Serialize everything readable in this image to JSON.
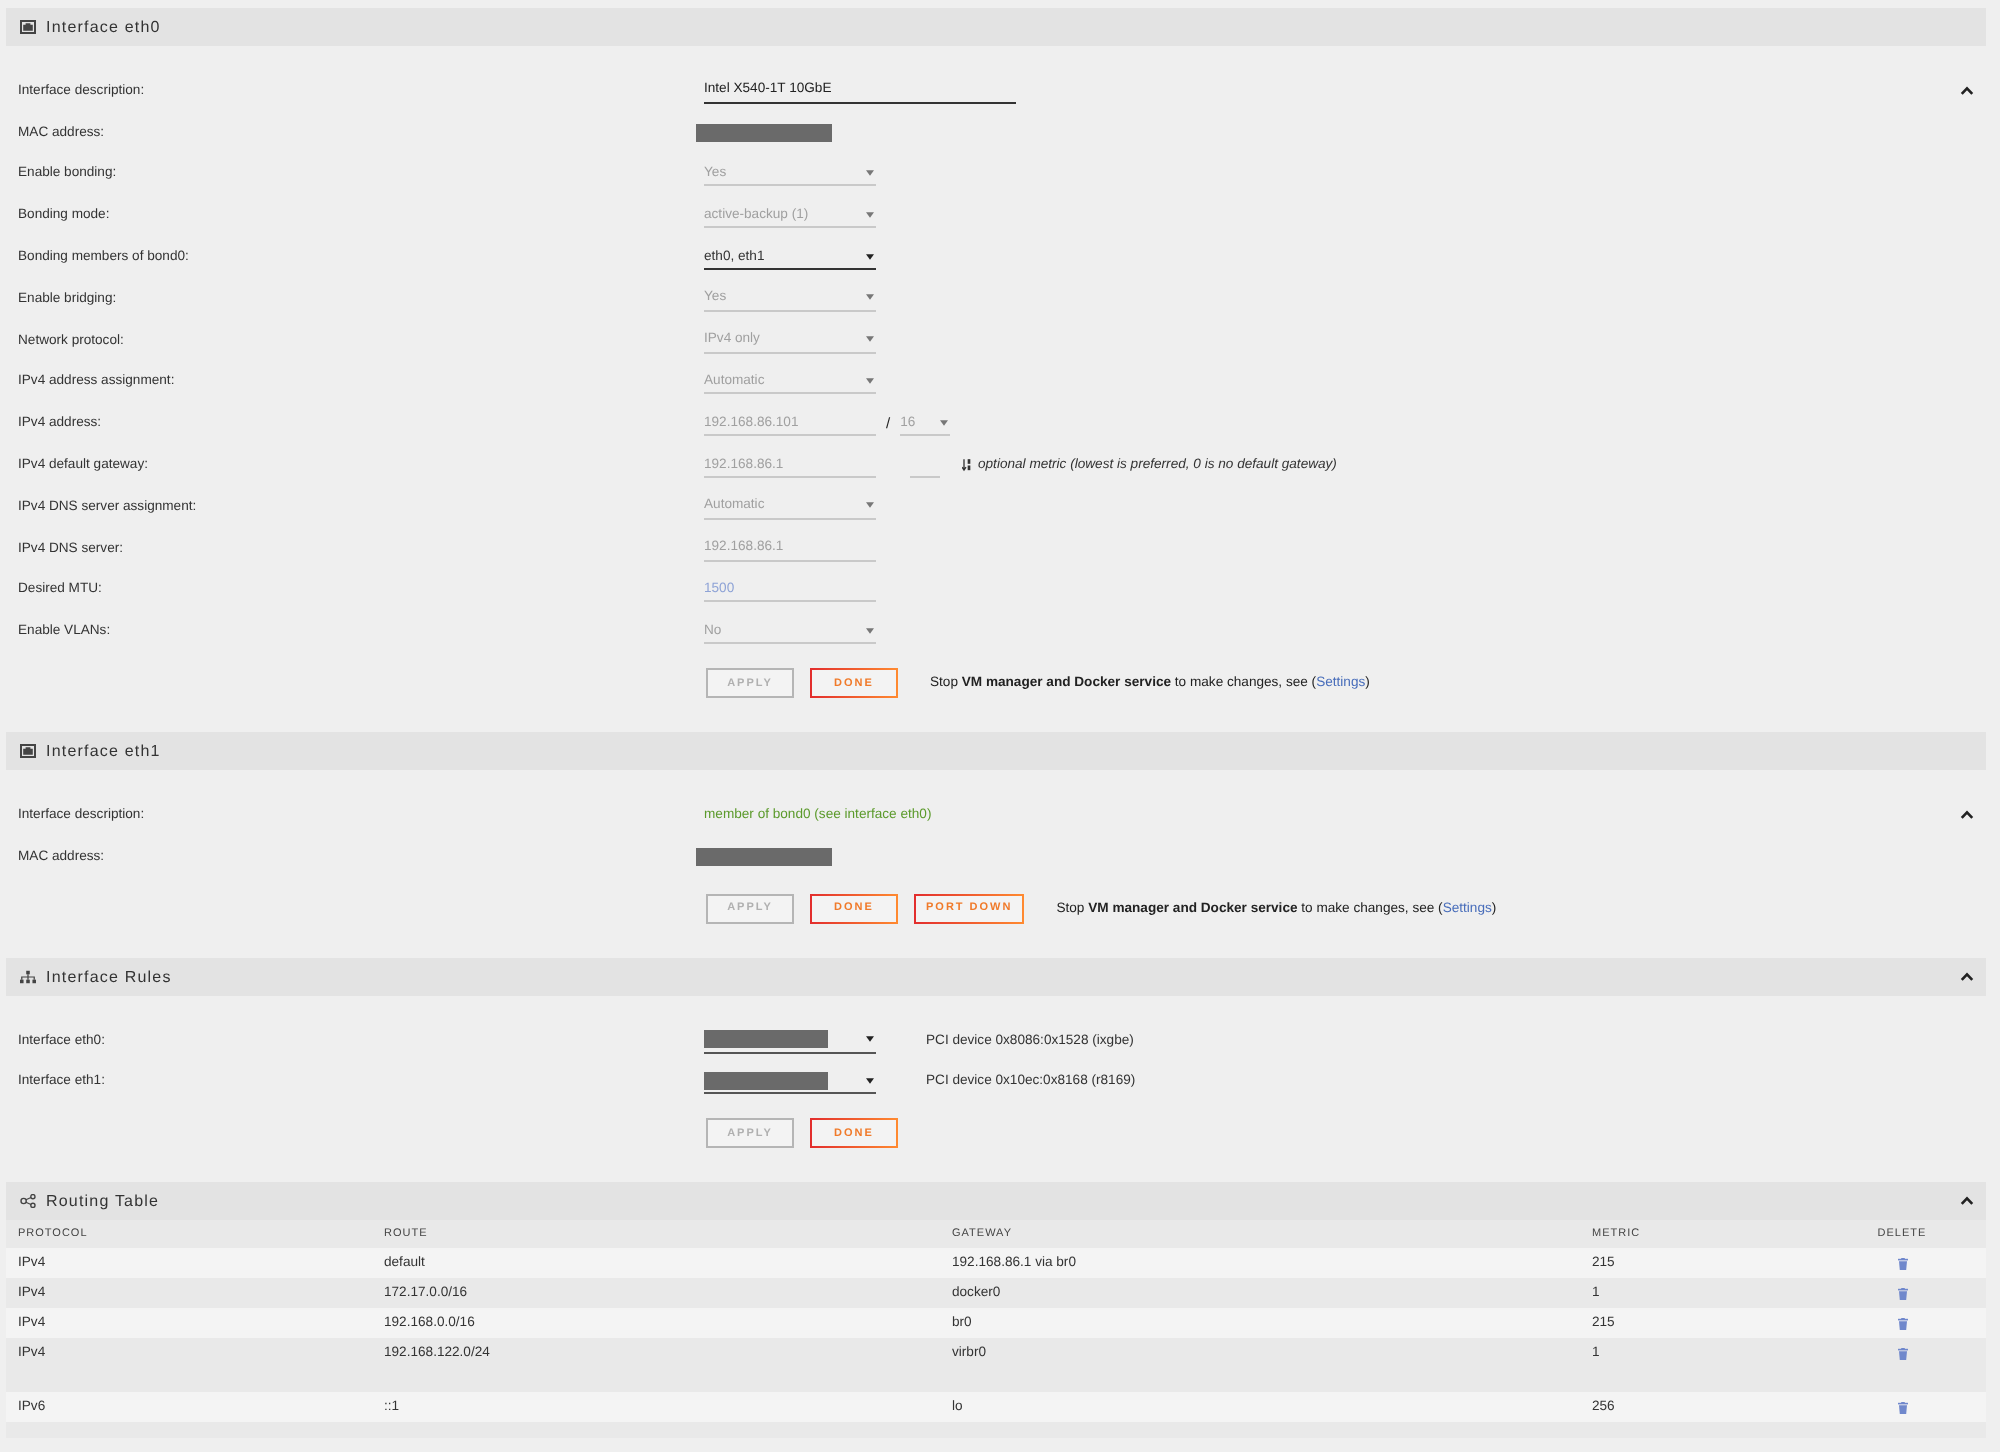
{
  "sections": [
    {
      "kind": "interface",
      "title": "Interface eth0",
      "expanded": true,
      "fields": [
        {
          "kind": "description",
          "label": "Interface description:",
          "value": "Intel X540-1T 10GbE",
          "disabled": false
        },
        {
          "kind": "redacted",
          "label": "MAC address:"
        },
        {
          "kind": "select",
          "label": "Enable bonding:",
          "value": "Yes",
          "disabled": true
        },
        {
          "kind": "select",
          "label": "Bonding mode:",
          "value": "active-backup (1)",
          "disabled": true
        },
        {
          "kind": "select",
          "label": "Bonding members of bond0:",
          "value": "eth0, eth1",
          "disabled": false
        },
        {
          "kind": "select",
          "label": "Enable bridging:",
          "value": "Yes",
          "disabled": true
        },
        {
          "kind": "select",
          "label": "Network protocol:",
          "value": "IPv4 only",
          "disabled": true
        },
        {
          "kind": "select",
          "label": "IPv4 address assignment:",
          "value": "Automatic",
          "disabled": true
        },
        {
          "kind": "address",
          "label": "IPv4 address:",
          "value": "192.168.86.101",
          "disabled": true,
          "separator": "/",
          "prefix": "16"
        },
        {
          "kind": "gateway",
          "label": "IPv4 default gateway:",
          "value": "192.168.86.1",
          "disabled": true,
          "hint": "optional metric (lowest is preferred, 0 is no default gateway)"
        },
        {
          "kind": "select",
          "label": "IPv4 DNS server assignment:",
          "value": "Automatic",
          "disabled": true
        },
        {
          "kind": "text",
          "label": "IPv4 DNS server:",
          "value": "192.168.86.1",
          "disabled": true
        },
        {
          "kind": "text",
          "label": "Desired MTU:",
          "placeholder": "1500",
          "disabled": true
        },
        {
          "kind": "select",
          "label": "Enable VLANs:",
          "value": "No",
          "disabled": true
        }
      ],
      "buttons": [
        {
          "label": "APPLY",
          "disabled": true
        },
        {
          "label": "DONE",
          "disabled": false
        }
      ],
      "notice": {
        "text": "Stop **VM manager and Docker service** to make changes, see (",
        "link": "Settings",
        "after": ")"
      }
    },
    {
      "kind": "interface",
      "title": "Interface eth1",
      "expanded": true,
      "fields": [
        {
          "kind": "note",
          "label": "Interface description:",
          "value": "member of bond0 (see interface eth0)"
        },
        {
          "kind": "redacted",
          "label": "MAC address:"
        }
      ],
      "buttons": [
        {
          "label": "APPLY",
          "disabled": true
        },
        {
          "label": "DONE",
          "disabled": false
        },
        {
          "label": "PORT DOWN",
          "disabled": false
        }
      ],
      "notice": {
        "text": "Stop **VM manager and Docker service** to make changes, see (",
        "link": "Settings",
        "after": ")"
      }
    },
    {
      "kind": "rules",
      "title": "Interface Rules",
      "expanded": true,
      "fields": [
        {
          "kind": "redacted_select",
          "label": "Interface eth0:",
          "info": "PCI device 0x8086:0x1528 (ixgbe)"
        },
        {
          "kind": "redacted_select",
          "label": "Interface eth1:",
          "info": "PCI device 0x10ec:0x8168 (r8169)"
        }
      ],
      "buttons": [
        {
          "label": "APPLY",
          "disabled": true
        },
        {
          "label": "DONE",
          "disabled": false
        }
      ]
    },
    {
      "kind": "table",
      "title": "Routing Table",
      "expanded": true,
      "columns": [
        "PROTOCOL",
        "ROUTE",
        "GATEWAY",
        "METRIC",
        "DELETE"
      ],
      "row_groups": [
        [
          [
            "IPv4",
            "default",
            "192.168.86.1 via br0",
            "215"
          ],
          [
            "IPv4",
            "172.17.0.0/16",
            "docker0",
            "1"
          ],
          [
            "IPv4",
            "192.168.0.0/16",
            "br0",
            "215"
          ],
          [
            "IPv4",
            "192.168.122.0/24",
            "virbr0",
            "1"
          ]
        ],
        [
          [
            "IPv6",
            "::1",
            "lo",
            "256"
          ]
        ]
      ]
    }
  ]
}
